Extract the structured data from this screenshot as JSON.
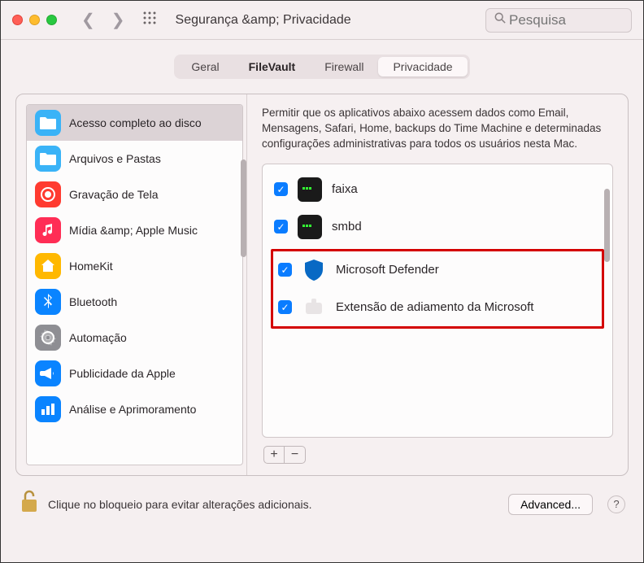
{
  "titlebar": {
    "title": "Segurança &amp; Privacidade",
    "search_placeholder": "Pesquisa"
  },
  "tabs": [
    {
      "label": "Geral"
    },
    {
      "label": "FileVault"
    },
    {
      "label": "Firewall"
    },
    {
      "label": "Privacidade"
    }
  ],
  "sidebar": {
    "items": [
      {
        "label": "Acesso completo ao disco",
        "icon": "folder",
        "color": "#3ab3f7"
      },
      {
        "label": "Arquivos e Pastas",
        "icon": "folder",
        "color": "#3ab3f7"
      },
      {
        "label": "Gravação de Tela",
        "icon": "target",
        "color": "#ff3b30"
      },
      {
        "label": "Mídia &amp; Apple Music",
        "icon": "music",
        "color": "#ff2d55"
      },
      {
        "label": "HomeKit",
        "icon": "home",
        "color": "#ffb800"
      },
      {
        "label": "Bluetooth",
        "icon": "bluetooth",
        "color": "#0a84ff"
      },
      {
        "label": "Automação",
        "icon": "gear",
        "color": "#8e8e93"
      },
      {
        "label": "Publicidade da Apple",
        "icon": "megaphone",
        "color": "#0a84ff"
      },
      {
        "label": "Análise e Aprimoramento",
        "icon": "chart",
        "color": "#0a84ff"
      }
    ]
  },
  "main": {
    "description": "Permitir que os aplicativos abaixo acessem dados como Email, Mensagens, Safari, Home, backups do Time Machine e determinadas configurações administrativas para todos os usuários nesta Mac.",
    "apps": [
      {
        "label": "faixa",
        "checked": true,
        "icon": "terminal"
      },
      {
        "label": "smbd",
        "checked": true,
        "icon": "terminal"
      },
      {
        "label": "Microsoft Defender",
        "checked": true,
        "icon": "shield",
        "highlighted": true
      },
      {
        "label": "Extensão de adiamento da Microsoft",
        "checked": true,
        "icon": "extension",
        "highlighted": true
      }
    ]
  },
  "footer": {
    "lock_text": "Clique no bloqueio para evitar alterações adicionais.",
    "advanced_label": "Advanced...",
    "help_label": "?"
  }
}
